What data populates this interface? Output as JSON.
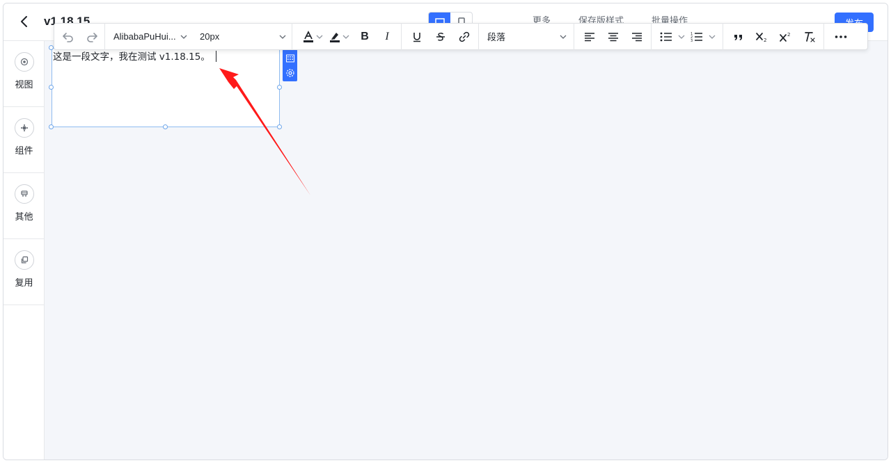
{
  "header": {
    "title": "v1.18.15",
    "actions": [
      "更多",
      "保存版样式",
      "批量操作"
    ],
    "publish_label": "发布"
  },
  "sidebar": {
    "items": [
      {
        "label": "视图",
        "icon": "view-icon"
      },
      {
        "label": "组件",
        "icon": "component-icon"
      },
      {
        "label": "其他",
        "icon": "other-icon"
      },
      {
        "label": "复用",
        "icon": "reuse-icon"
      }
    ]
  },
  "toolbar": {
    "font_family": "AlibabaPuHui...",
    "font_size": "20px",
    "block_type": "段落",
    "icons": [
      "undo-icon",
      "redo-icon",
      "font-color-icon",
      "highlight-icon",
      "bold-icon",
      "italic-icon",
      "underline-icon",
      "strikethrough-icon",
      "link-icon",
      "align-left-icon",
      "align-center-icon",
      "align-right-icon",
      "bullet-list-icon",
      "ordered-list-icon",
      "quote-icon",
      "subscript-icon",
      "superscript-icon",
      "clear-format-icon",
      "more-icon"
    ],
    "bold_glyph": "B",
    "italic_glyph": "I"
  },
  "text_component": {
    "content": "这是一段文字，我在测试 v1.18.15。"
  },
  "colors": {
    "accent": "#3370ff",
    "selection_border": "#8fbcf0",
    "canvas_bg": "#f4f6fa",
    "annotation_arrow": "#ff1a1a"
  }
}
